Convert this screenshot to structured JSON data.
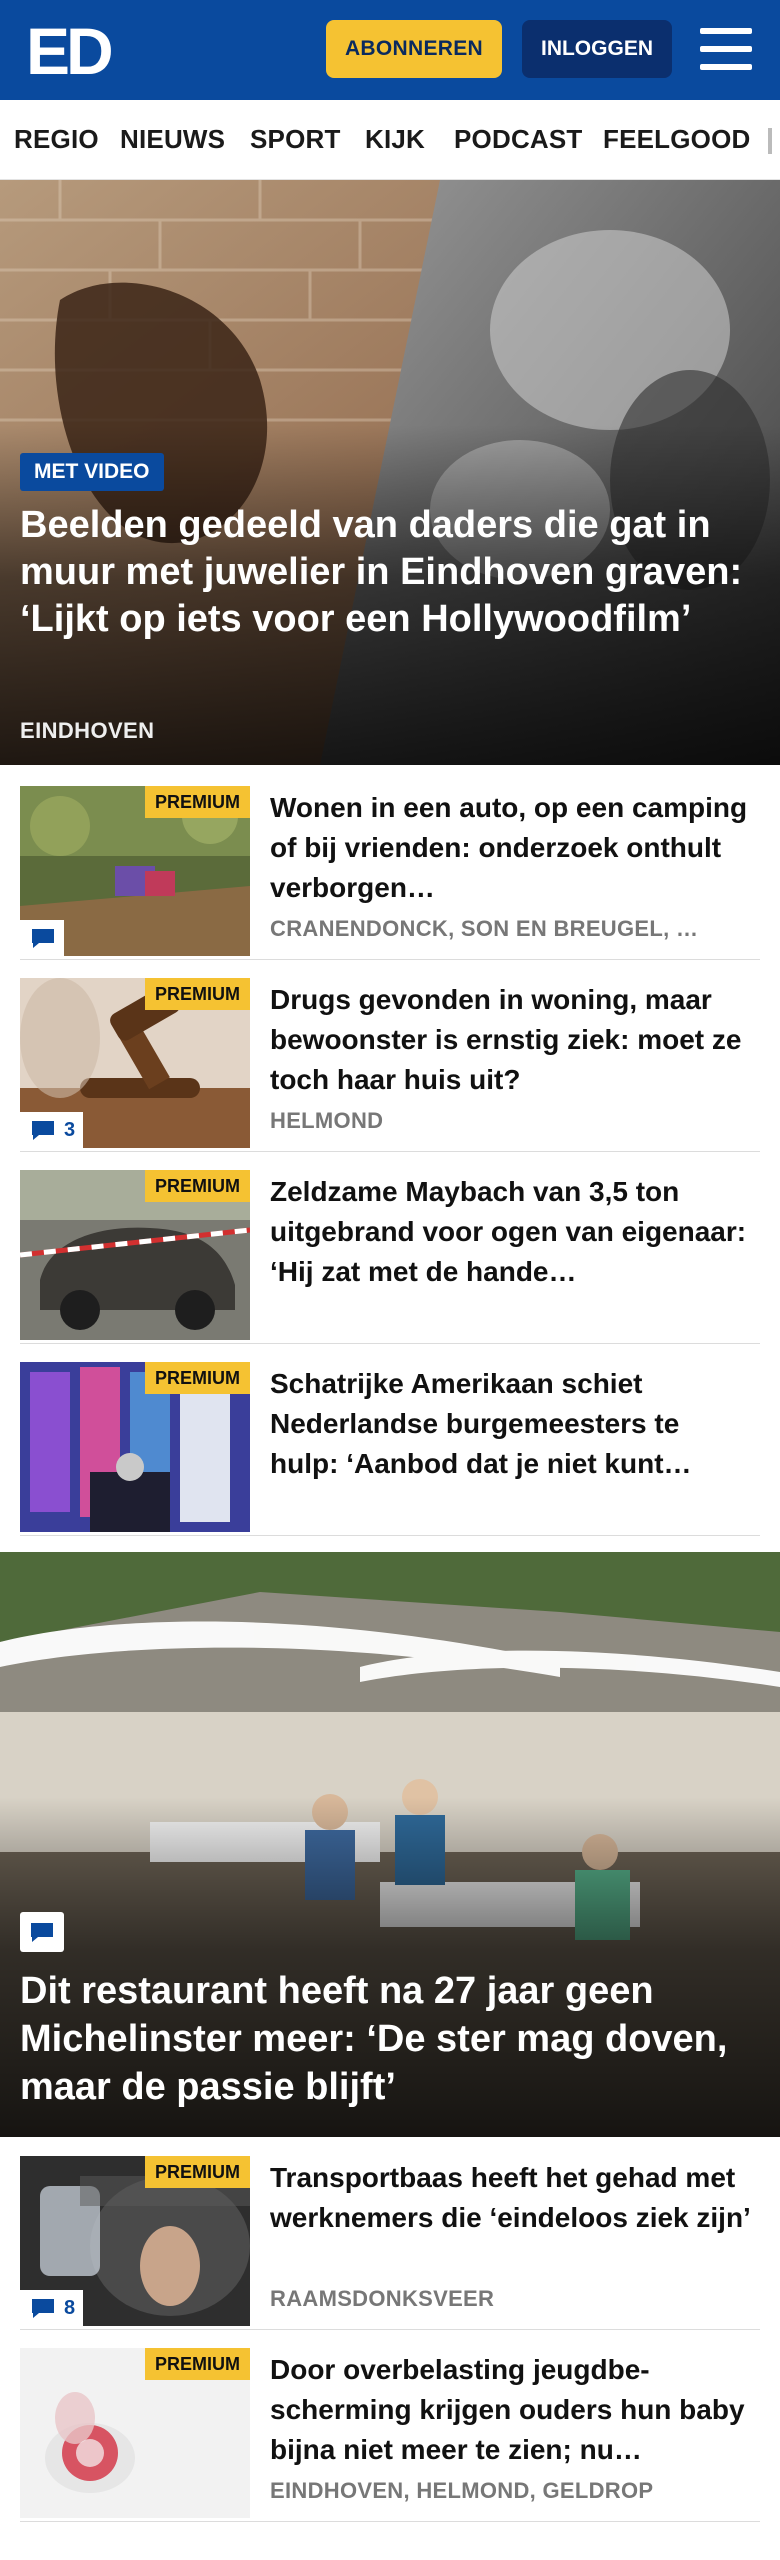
{
  "header": {
    "logo_text": "ED",
    "subscribe_label": "ABONNEREN",
    "login_label": "INLOGGEN",
    "menu_icon": "hamburger-menu-icon",
    "brand_color": "#0a4a9e",
    "accent_color": "#f5c232"
  },
  "nav": {
    "items": [
      "REGIO",
      "NIEUWS",
      "SPORT",
      "KIJK",
      "PODCAST",
      "FEELGOOD"
    ]
  },
  "hero": {
    "badge": "MET VIDEO",
    "title": "Beelden gedeeld van daders die gat in muur met juwelier in Eindhoven graven: ‘Lijkt op iets voor een Hollywoodfilm’",
    "location": "EINDHOVEN"
  },
  "articles": [
    {
      "premium": "PREMIUM",
      "title": "Wonen in een auto, op een camping of bij vrienden: onderzoek onthult verborgen…",
      "location": "CRANENDONCK, SON EN BREUGEL, …",
      "comments": ""
    },
    {
      "premium": "PREMIUM",
      "title": "Drugs gevonden in woning, maar bewoonster is ernstig ziek: moet ze toch haar huis uit?",
      "location": "HELMOND",
      "comments": "3"
    },
    {
      "premium": "PREMIUM",
      "title": "Zeldzame Maybach van 3,5 ton uitgebrand voor ogen van eigenaar: ‘Hij zat met de hande…",
      "location": "",
      "comments": ""
    },
    {
      "premium": "PREMIUM",
      "title": "Schatrijke Amerikaan schiet Nederlandse burgemeesters te hulp: ‘Aanbod dat je niet kunt…",
      "location": "",
      "comments": ""
    }
  ],
  "hero2": {
    "title": "Dit restaurant heeft na 27 jaar geen Michelinster meer: ‘De ster mag doven, maar de passie blijft’"
  },
  "articles2": [
    {
      "premium": "PREMIUM",
      "title": "Transportbaas heeft het gehad met werknemers die ‘eindeloos ziek zijn’",
      "location": "RAAMSDONKSVEER",
      "comments": "8"
    },
    {
      "premium": "PREMIUM",
      "title": "Door overbelasting jeugdbe­scherming krijgen ouders hun baby bijna niet meer te zien; nu…",
      "location": "EINDHOVEN, HELMOND, GELDROP",
      "comments": ""
    }
  ]
}
